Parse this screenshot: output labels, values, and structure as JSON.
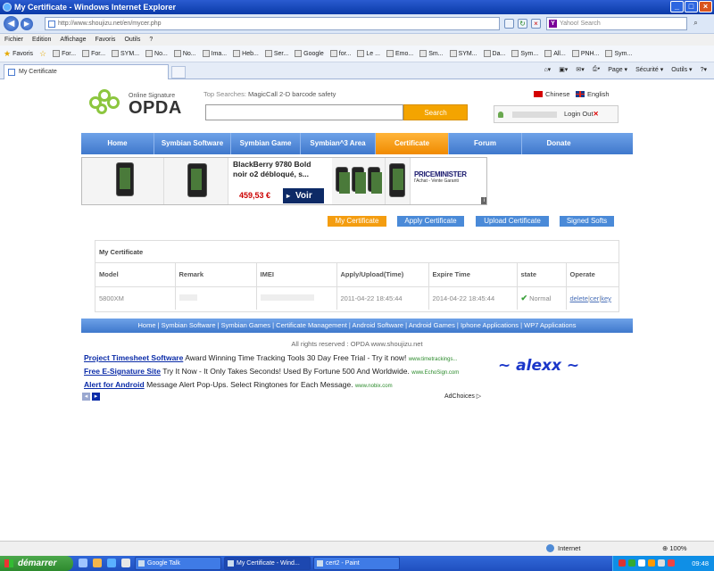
{
  "window": {
    "title": "My Certificate - Windows Internet Explorer",
    "url": "http://www.shoujizu.net/en/mycer.php",
    "search_placeholder": "Yahoo! Search",
    "tab_title": "My Certificate"
  },
  "menu": [
    "Fichier",
    "Edition",
    "Affichage",
    "Favoris",
    "Outils",
    "?"
  ],
  "favorites": {
    "label": "Favoris",
    "items": [
      "For...",
      "For...",
      "SYM...",
      "No...",
      "No...",
      "Ima...",
      "Heb...",
      "Ser...",
      "Google",
      "for...",
      "Le ...",
      "Emo...",
      "Sm...",
      "SYM...",
      "Da...",
      "Sym...",
      "All...",
      "PNH...",
      "Sym..."
    ]
  },
  "commandbar": [
    "Page ▾",
    "Sécurité ▾",
    "Outils ▾"
  ],
  "site": {
    "logo_tagline": "Online Signature",
    "logo_name": "OPDA",
    "top_searches_label": "Top Searches:",
    "top_searches": "MagicCall  2-D barcode  safety",
    "search_button": "Search",
    "lang_chinese": "Chinese",
    "lang_english": "English",
    "logout_label": "Login Out",
    "nav": [
      "Home",
      "Symbian Software",
      "Symbian Game",
      "Symbian^3 Area",
      "Certificate",
      "Forum",
      "Donate"
    ]
  },
  "ad_banner": {
    "title": "BlackBerry 9780 Bold noir o2 débloqué, s...",
    "price": "459,53 €",
    "cta": "Voir",
    "brand": "PRICEMINISTER",
    "brand_sub": "l'Achat - Vente Garanti"
  },
  "cert_buttons": [
    "My Certificate",
    "Apply Certificate",
    "Upload Certificate",
    "Signed Softs"
  ],
  "cert_panel": {
    "title": "My Certificate",
    "columns": [
      "Model",
      "Remark",
      "IMEI",
      "Apply/Upload(Time)",
      "Expire Time",
      "state",
      "Operate"
    ],
    "rows": [
      {
        "model": "5800XM",
        "apply_time": "2011-04-22 18:45:44",
        "expire_time": "2014-04-22 18:45:44",
        "state": "Normal",
        "operate": [
          "delete",
          "cer",
          "key"
        ]
      }
    ]
  },
  "footer_nav": "Home | Symbian Software | Symbian Games | Certificate Management | Android Software | Android Games | Iphone Applications | WP7 Applications",
  "copyright": "All rights reserved : OPDA www.shoujizu.net",
  "text_ads": [
    {
      "headline": "Project Timesheet Software",
      "body": "Award Winning Time Tracking Tools 30 Day Free Trial - Try it now!",
      "url": "www.timetrackings..."
    },
    {
      "headline": "Free E-Signature Site",
      "body": "Try It Now - It Only Takes Seconds! Used By Fortune 500 And Worldwide.",
      "url": "www.EchoSign.com"
    },
    {
      "headline": "Alert for Android",
      "body": "Message Alert Pop-Ups. Select Ringtones for Each Message.",
      "url": "www.nobix.com"
    }
  ],
  "adchoices": "AdChoices ▷",
  "handwritten": "~ alexx ~",
  "statusbar": {
    "zone": "Internet",
    "zoom": "100%"
  },
  "taskbar": {
    "start": "démarrer",
    "items": [
      "Google Talk",
      "My Certificate - Wind...",
      "cert2 - Paint"
    ],
    "clock": "09:48"
  },
  "colors": {
    "nav_blue": "#4f88d8",
    "active_orange": "#f49d10",
    "link_blue": "#0b2ca8"
  }
}
